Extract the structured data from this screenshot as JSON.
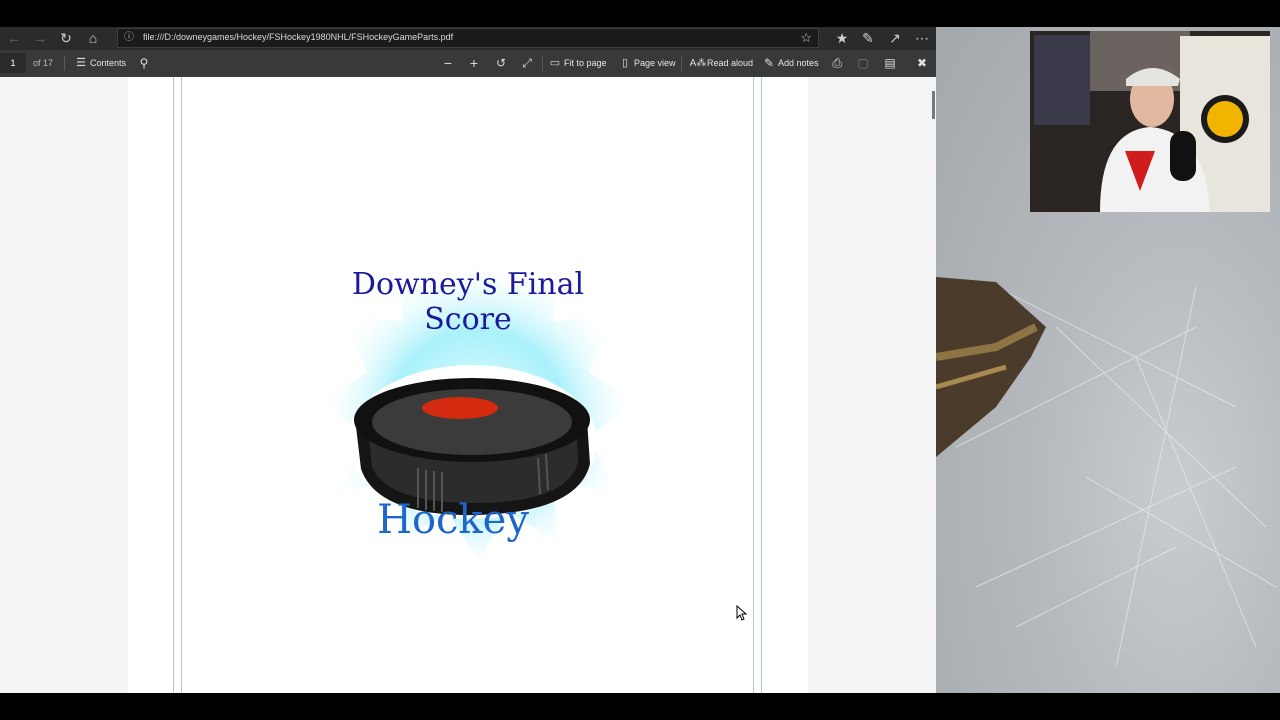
{
  "browser": {
    "url": "file:///D:/downeygames/Hockey/FSHockey1980NHL/FSHockeyGameParts.pdf"
  },
  "pdf_toolbar": {
    "page_number": "1",
    "page_total": "of 17",
    "contents_label": "Contents",
    "fit_to_page_label": "Fit to page",
    "page_view_label": "Page view",
    "read_aloud_label": "Read aloud",
    "add_notes_label": "Add notes"
  },
  "document": {
    "title": "Downey's Final Score",
    "subtitle": "Hockey"
  },
  "icons": {
    "back": "back-arrow-icon",
    "forward": "forward-arrow-icon",
    "refresh": "refresh-icon",
    "home": "home-icon",
    "favorite": "star-icon",
    "favorites_list": "favorites-icon",
    "notes": "pen-icon",
    "share": "share-icon",
    "more": "more-icon",
    "search": "search-icon",
    "zoom_out": "minus-icon",
    "zoom_in": "plus-icon",
    "rotate": "rotate-icon",
    "fullscreen": "expand-icon",
    "print": "print-icon",
    "save": "save-icon",
    "save_as": "save-as-icon",
    "pin": "pin-icon"
  },
  "colors": {
    "title_text": "#1a1a9c",
    "hockey_text": "#1f66cc",
    "puck_center": "#d42a10",
    "halo": "#bff3fb"
  }
}
